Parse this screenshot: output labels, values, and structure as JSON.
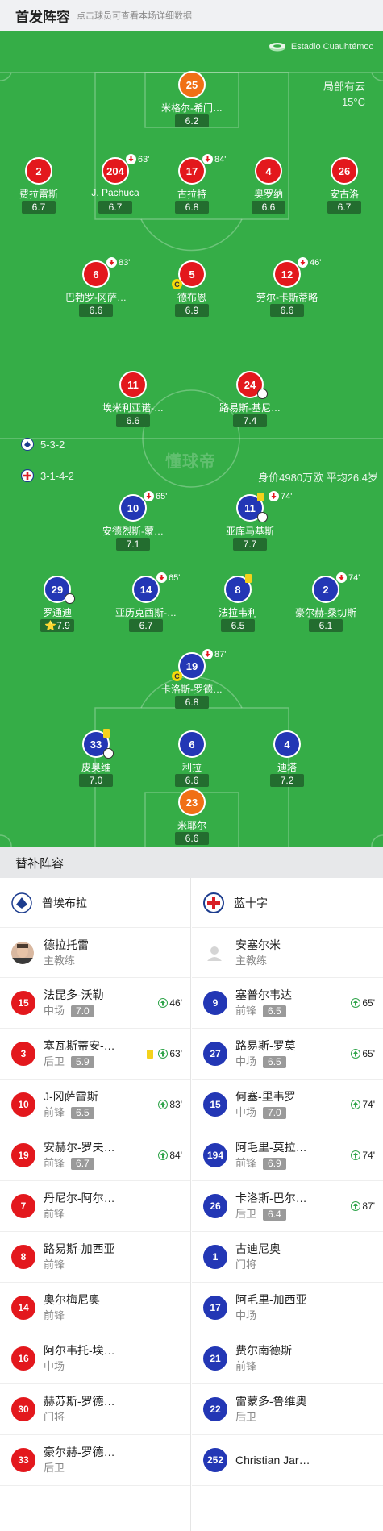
{
  "header": {
    "title": "首发阵容",
    "hint": "点击球员可查看本场详细数据"
  },
  "pitch": {
    "venue": "Estadio Cuauhtémoc",
    "weather": [
      "局部有云",
      "15°C"
    ],
    "watermark": "懂球帝",
    "home_formation": "5-3-2",
    "away_formation": "3-1-4-2",
    "away_value": "身价4980万欧 平均26.4岁"
  },
  "home_players": [
    {
      "number": "25",
      "name": "米格尔-希门…",
      "rating": "6.2",
      "color": "orange"
    },
    {
      "number": "2",
      "name": "费拉雷斯",
      "rating": "6.7",
      "color": "red"
    },
    {
      "number": "204",
      "name": "J. Pachuca",
      "rating": "6.7",
      "color": "red",
      "sub_min": "63'"
    },
    {
      "number": "17",
      "name": "古拉特",
      "rating": "6.8",
      "color": "red",
      "sub_min": "84'"
    },
    {
      "number": "4",
      "name": "奥罗纳",
      "rating": "6.6",
      "color": "red"
    },
    {
      "number": "26",
      "name": "安古洛",
      "rating": "6.7",
      "color": "red"
    },
    {
      "number": "6",
      "name": "巴勃罗-冈萨…",
      "rating": "6.6",
      "color": "red",
      "sub_min": "83'"
    },
    {
      "number": "5",
      "name": "德布恩",
      "rating": "6.9",
      "color": "red",
      "captain": "C"
    },
    {
      "number": "12",
      "name": "劳尔-卡斯蒂略",
      "rating": "6.6",
      "color": "red",
      "sub_min": "46'"
    },
    {
      "number": "11",
      "name": "埃米利亚诺-…",
      "rating": "6.6",
      "color": "red"
    },
    {
      "number": "24",
      "name": "路易斯-基尼…",
      "rating": "7.4",
      "color": "red"
    }
  ],
  "away_players": [
    {
      "number": "10",
      "name": "安德烈斯-蒙…",
      "rating": "7.1",
      "color": "blue",
      "sub_min": "65'"
    },
    {
      "number": "11",
      "name": "亚库马基斯",
      "rating": "7.7",
      "color": "blue",
      "sub_min": "74'"
    },
    {
      "number": "29",
      "name": "罗通迪",
      "rating": "7.9",
      "color": "blue",
      "star": "⭐"
    },
    {
      "number": "14",
      "name": "亚历克西斯-…",
      "rating": "6.7",
      "color": "blue",
      "sub_min": "65'"
    },
    {
      "number": "8",
      "name": "法拉韦利",
      "rating": "6.5",
      "color": "blue"
    },
    {
      "number": "2",
      "name": "豪尔赫-桑切斯",
      "rating": "6.1",
      "color": "blue",
      "sub_min": "74'"
    },
    {
      "number": "19",
      "name": "卡洛斯-罗德…",
      "rating": "6.8",
      "color": "blue",
      "sub_min": "87'",
      "captain": "C"
    },
    {
      "number": "33",
      "name": "皮奥维",
      "rating": "7.0",
      "color": "blue"
    },
    {
      "number": "6",
      "name": "利拉",
      "rating": "6.6",
      "color": "blue"
    },
    {
      "number": "4",
      "name": "迪塔",
      "rating": "7.2",
      "color": "blue"
    },
    {
      "number": "23",
      "name": "米耶尔",
      "rating": "6.6",
      "color": "orange"
    }
  ],
  "subs": {
    "title": "替补阵容",
    "home": {
      "team": "普埃布拉",
      "coach": {
        "name": "德拉托雷",
        "role": "主教练"
      },
      "players": [
        {
          "number": "15",
          "name": "法昆多-沃勒",
          "position": "中场",
          "rating": "7.0",
          "minute": "46'"
        },
        {
          "number": "3",
          "name": "塞瓦斯蒂安-…",
          "position": "后卫",
          "rating": "5.9",
          "minute": "63'"
        },
        {
          "number": "10",
          "name": "J-冈萨雷斯",
          "position": "前锋",
          "rating": "6.5",
          "minute": "83'"
        },
        {
          "number": "19",
          "name": "安赫尔-罗夫…",
          "position": "前锋",
          "rating": "6.7",
          "minute": "84'"
        },
        {
          "number": "7",
          "name": "丹尼尔-阿尔…",
          "position": "前锋"
        },
        {
          "number": "8",
          "name": "路易斯-加西亚",
          "position": "前锋"
        },
        {
          "number": "14",
          "name": "奥尔梅尼奥",
          "position": "前锋"
        },
        {
          "number": "16",
          "name": "阿尔韦托-埃…",
          "position": "中场"
        },
        {
          "number": "30",
          "name": "赫苏斯-罗德…",
          "position": "门将"
        },
        {
          "number": "33",
          "name": "豪尔赫-罗德…",
          "position": "后卫"
        }
      ]
    },
    "away": {
      "team": "蓝十字",
      "coach": {
        "name": "安塞尔米",
        "role": "主教练"
      },
      "players": [
        {
          "number": "9",
          "name": "塞普尔韦达",
          "position": "前锋",
          "rating": "6.5",
          "minute": "65'"
        },
        {
          "number": "27",
          "name": "路易斯-罗莫",
          "position": "中场",
          "rating": "6.5",
          "minute": "65'"
        },
        {
          "number": "15",
          "name": "何塞-里韦罗",
          "position": "中场",
          "rating": "7.0",
          "minute": "74'"
        },
        {
          "number": "194",
          "name": "阿毛里-莫拉…",
          "position": "前锋",
          "rating": "6.9",
          "minute": "74'"
        },
        {
          "number": "26",
          "name": "卡洛斯-巴尔…",
          "position": "后卫",
          "rating": "6.4",
          "minute": "87'"
        },
        {
          "number": "1",
          "name": "古迪尼奥",
          "position": "门将"
        },
        {
          "number": "17",
          "name": "阿毛里-加西亚",
          "position": "中场"
        },
        {
          "number": "21",
          "name": "费尔南德斯",
          "position": "前锋"
        },
        {
          "number": "22",
          "name": "雷蒙多-鲁维奥",
          "position": "后卫"
        },
        {
          "number": "252",
          "name": "Christian Jare…",
          "position": ""
        }
      ]
    }
  }
}
